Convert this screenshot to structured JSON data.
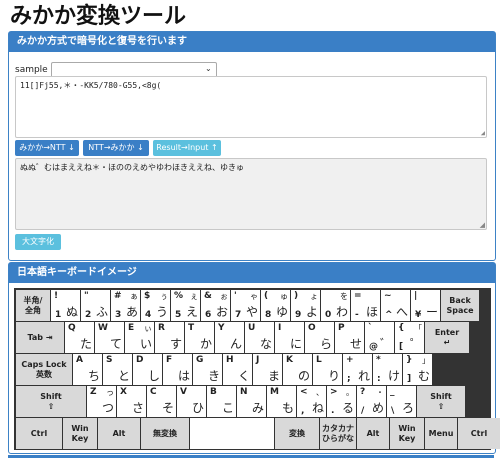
{
  "page": {
    "title": "みかか変換ツール"
  },
  "converter": {
    "header": "みかか方式で暗号化と復号を行います",
    "sample_label": "sample",
    "sample_value": "",
    "input_text": "11[]Fj55,＊・-KK5/780-G55,<8g(",
    "output_text": "ぬぬ゛むはまええね＊・ほののえめやゆわほきええね、ゆきゅ",
    "btn_to_ntt": "みかか→NTT ↓",
    "btn_to_mikaka": "NTT→みかか ↓",
    "btn_result": "Result→Input ↑",
    "btn_upper": "大文字化"
  },
  "keyboard": {
    "header": "日本語キーボードイメージ",
    "rows": [
      [
        {
          "c": "半角/\n全角",
          "w": 34,
          "g": 1
        },
        {
          "t": "!",
          "tr": "",
          "b": "1",
          "br": "ぬ"
        },
        {
          "t": "\"",
          "tr": "",
          "b": "2",
          "br": "ふ"
        },
        {
          "t": "#",
          "tr": "ぁ",
          "b": "3",
          "br": "あ"
        },
        {
          "t": "$",
          "tr": "ぅ",
          "b": "4",
          "br": "う"
        },
        {
          "t": "%",
          "tr": "ぇ",
          "b": "5",
          "br": "え"
        },
        {
          "t": "&",
          "tr": "ぉ",
          "b": "6",
          "br": "お"
        },
        {
          "t": "'",
          "tr": "ゃ",
          "b": "7",
          "br": "や"
        },
        {
          "t": "(",
          "tr": "ゅ",
          "b": "8",
          "br": "ゆ"
        },
        {
          "t": ")",
          "tr": "ょ",
          "b": "9",
          "br": "よ"
        },
        {
          "t": "",
          "tr": "を",
          "b": "0",
          "br": "わ"
        },
        {
          "t": "=",
          "tr": "",
          "b": "-",
          "br": "ほ"
        },
        {
          "t": "~",
          "tr": "",
          "b": "^",
          "br": "へ"
        },
        {
          "t": "|",
          "tr": "",
          "b": "¥",
          "br": "ー"
        },
        {
          "c": "Back\nSpace",
          "w": 38,
          "g": 1
        }
      ],
      [
        {
          "c": "Tab ⇥",
          "w": 48,
          "g": 1
        },
        {
          "t": "Q",
          "tr": "",
          "b": "",
          "br": "た"
        },
        {
          "t": "W",
          "tr": "",
          "b": "",
          "br": "て"
        },
        {
          "t": "E",
          "tr": "ぃ",
          "b": "",
          "br": "い"
        },
        {
          "t": "R",
          "tr": "",
          "b": "",
          "br": "す"
        },
        {
          "t": "T",
          "tr": "",
          "b": "",
          "br": "か"
        },
        {
          "t": "Y",
          "tr": "",
          "b": "",
          "br": "ん"
        },
        {
          "t": "U",
          "tr": "",
          "b": "",
          "br": "な"
        },
        {
          "t": "I",
          "tr": "",
          "b": "",
          "br": "に"
        },
        {
          "t": "O",
          "tr": "",
          "b": "",
          "br": "ら"
        },
        {
          "t": "P",
          "tr": "",
          "b": "",
          "br": "せ"
        },
        {
          "t": "`",
          "tr": "",
          "b": "@",
          "br": "゛"
        },
        {
          "t": "{",
          "tr": "「",
          "b": "[",
          "br": "゜"
        },
        {
          "c": "Enter\n↵",
          "w": 44,
          "g": 1
        }
      ],
      [
        {
          "c": "Caps Lock\n英数",
          "w": 56,
          "g": 1
        },
        {
          "t": "A",
          "tr": "",
          "b": "",
          "br": "ち"
        },
        {
          "t": "S",
          "tr": "",
          "b": "",
          "br": "と"
        },
        {
          "t": "D",
          "tr": "",
          "b": "",
          "br": "し"
        },
        {
          "t": "F",
          "tr": "",
          "b": "",
          "br": "は"
        },
        {
          "t": "G",
          "tr": "",
          "b": "",
          "br": "き"
        },
        {
          "t": "H",
          "tr": "",
          "b": "",
          "br": "く"
        },
        {
          "t": "J",
          "tr": "",
          "b": "",
          "br": "ま"
        },
        {
          "t": "K",
          "tr": "",
          "b": "",
          "br": "の"
        },
        {
          "t": "L",
          "tr": "",
          "b": "",
          "br": "り"
        },
        {
          "t": "+",
          "tr": "",
          "b": ";",
          "br": "れ"
        },
        {
          "t": "*",
          "tr": "",
          "b": ":",
          "br": "け"
        },
        {
          "t": "}",
          "tr": "」",
          "b": "]",
          "br": "む"
        }
      ],
      [
        {
          "c": "Shift\n⇧",
          "w": 70,
          "g": 1
        },
        {
          "t": "Z",
          "tr": "っ",
          "b": "",
          "br": "つ"
        },
        {
          "t": "X",
          "tr": "",
          "b": "",
          "br": "さ"
        },
        {
          "t": "C",
          "tr": "",
          "b": "",
          "br": "そ"
        },
        {
          "t": "V",
          "tr": "",
          "b": "",
          "br": "ひ"
        },
        {
          "t": "B",
          "tr": "",
          "b": "",
          "br": "こ"
        },
        {
          "t": "N",
          "tr": "",
          "b": "",
          "br": "み"
        },
        {
          "t": "M",
          "tr": "",
          "b": "",
          "br": "も"
        },
        {
          "t": "<",
          "tr": "、",
          "b": ",",
          "br": "ね"
        },
        {
          "t": ">",
          "tr": "。",
          "b": ".",
          "br": "る"
        },
        {
          "t": "?",
          "tr": "・",
          "b": "/",
          "br": "め"
        },
        {
          "t": "_",
          "tr": "",
          "b": "\\",
          "br": "ろ"
        },
        {
          "c": "Shift\n⇧",
          "w": 48,
          "g": 1
        }
      ],
      [
        {
          "c": "Ctrl",
          "w": 46,
          "g": 1
        },
        {
          "c": "Win\nKey",
          "w": 34,
          "g": 1
        },
        {
          "c": "Alt",
          "w": 42,
          "g": 1
        },
        {
          "c": "無変換",
          "w": 48,
          "g": 1
        },
        {
          "c": "",
          "w": 84,
          "g": 0
        },
        {
          "c": "変換",
          "w": 44,
          "g": 1
        },
        {
          "c": "カタカナ\nひらがな",
          "w": 36,
          "g": 1
        },
        {
          "c": "Alt",
          "w": 32,
          "g": 1
        },
        {
          "c": "Win\nKey",
          "w": 34,
          "g": 1
        },
        {
          "c": "Menu",
          "w": 32,
          "g": 1
        },
        {
          "c": "Ctrl",
          "w": 42,
          "g": 1
        }
      ]
    ]
  }
}
